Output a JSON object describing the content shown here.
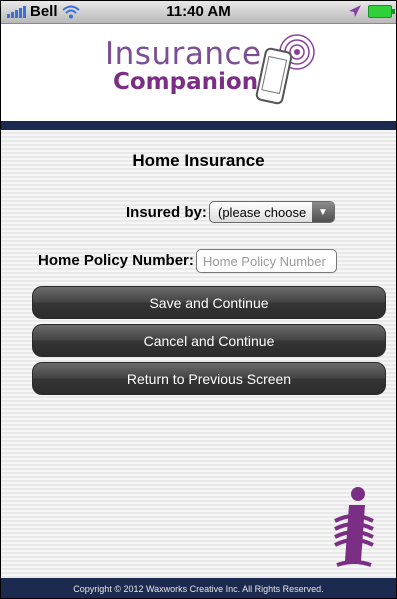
{
  "status_bar": {
    "carrier": "Bell",
    "time": "11:40 AM",
    "icons": [
      "signal-bars-icon",
      "wifi-icon",
      "location-arrow-icon",
      "battery-icon"
    ]
  },
  "app": {
    "logo_line1": "Insurance",
    "logo_line2": "Companion",
    "brand_colors": {
      "purple": "#7a2f84",
      "navy": "#1d2a4f"
    }
  },
  "form": {
    "title": "Home Insurance",
    "insured_by_label": "Insured by:",
    "insured_by_value": "(please choose",
    "policy_number_label": "Home Policy Number:",
    "policy_number_value": "",
    "policy_number_placeholder": "Home Policy Number"
  },
  "buttons": {
    "save": "Save and Continue",
    "cancel": "Cancel and Continue",
    "back": "Return to Previous Screen"
  },
  "footer": {
    "copyright": "Copyright © 2012 Waxworks Creative Inc. All Rights Reserved."
  }
}
